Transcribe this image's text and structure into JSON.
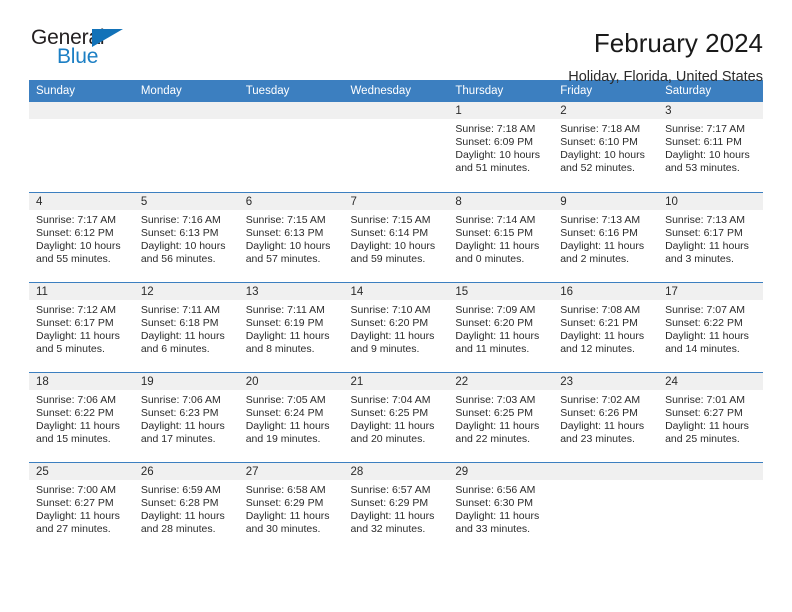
{
  "logo": {
    "word_top": "General",
    "word_bottom": "Blue",
    "triangle_color": "#1272b8",
    "blue_color": "#1c7fc4"
  },
  "header": {
    "title": "February 2024",
    "location": "Holiday, Florida, United States"
  },
  "theme": {
    "header_blue": "#3c7fc0",
    "daynum_band": "#f0f0f0",
    "text": "#2b2b2b"
  },
  "calendar": {
    "weekday_headers": [
      "Sunday",
      "Monday",
      "Tuesday",
      "Wednesday",
      "Thursday",
      "Friday",
      "Saturday"
    ],
    "labels": {
      "sunrise": "Sunrise:",
      "sunset": "Sunset:",
      "daylight": "Daylight:"
    },
    "weeks": [
      [
        {
          "day": "",
          "blank": true
        },
        {
          "day": "",
          "blank": true
        },
        {
          "day": "",
          "blank": true
        },
        {
          "day": "",
          "blank": true
        },
        {
          "day": "1",
          "sunrise": "Sunrise: 7:18 AM",
          "sunset": "Sunset: 6:09 PM",
          "daylight": "Daylight: 10 hours and 51 minutes."
        },
        {
          "day": "2",
          "sunrise": "Sunrise: 7:18 AM",
          "sunset": "Sunset: 6:10 PM",
          "daylight": "Daylight: 10 hours and 52 minutes."
        },
        {
          "day": "3",
          "sunrise": "Sunrise: 7:17 AM",
          "sunset": "Sunset: 6:11 PM",
          "daylight": "Daylight: 10 hours and 53 minutes."
        }
      ],
      [
        {
          "day": "4",
          "sunrise": "Sunrise: 7:17 AM",
          "sunset": "Sunset: 6:12 PM",
          "daylight": "Daylight: 10 hours and 55 minutes."
        },
        {
          "day": "5",
          "sunrise": "Sunrise: 7:16 AM",
          "sunset": "Sunset: 6:13 PM",
          "daylight": "Daylight: 10 hours and 56 minutes."
        },
        {
          "day": "6",
          "sunrise": "Sunrise: 7:15 AM",
          "sunset": "Sunset: 6:13 PM",
          "daylight": "Daylight: 10 hours and 57 minutes."
        },
        {
          "day": "7",
          "sunrise": "Sunrise: 7:15 AM",
          "sunset": "Sunset: 6:14 PM",
          "daylight": "Daylight: 10 hours and 59 minutes."
        },
        {
          "day": "8",
          "sunrise": "Sunrise: 7:14 AM",
          "sunset": "Sunset: 6:15 PM",
          "daylight": "Daylight: 11 hours and 0 minutes."
        },
        {
          "day": "9",
          "sunrise": "Sunrise: 7:13 AM",
          "sunset": "Sunset: 6:16 PM",
          "daylight": "Daylight: 11 hours and 2 minutes."
        },
        {
          "day": "10",
          "sunrise": "Sunrise: 7:13 AM",
          "sunset": "Sunset: 6:17 PM",
          "daylight": "Daylight: 11 hours and 3 minutes."
        }
      ],
      [
        {
          "day": "11",
          "sunrise": "Sunrise: 7:12 AM",
          "sunset": "Sunset: 6:17 PM",
          "daylight": "Daylight: 11 hours and 5 minutes."
        },
        {
          "day": "12",
          "sunrise": "Sunrise: 7:11 AM",
          "sunset": "Sunset: 6:18 PM",
          "daylight": "Daylight: 11 hours and 6 minutes."
        },
        {
          "day": "13",
          "sunrise": "Sunrise: 7:11 AM",
          "sunset": "Sunset: 6:19 PM",
          "daylight": "Daylight: 11 hours and 8 minutes."
        },
        {
          "day": "14",
          "sunrise": "Sunrise: 7:10 AM",
          "sunset": "Sunset: 6:20 PM",
          "daylight": "Daylight: 11 hours and 9 minutes."
        },
        {
          "day": "15",
          "sunrise": "Sunrise: 7:09 AM",
          "sunset": "Sunset: 6:20 PM",
          "daylight": "Daylight: 11 hours and 11 minutes."
        },
        {
          "day": "16",
          "sunrise": "Sunrise: 7:08 AM",
          "sunset": "Sunset: 6:21 PM",
          "daylight": "Daylight: 11 hours and 12 minutes."
        },
        {
          "day": "17",
          "sunrise": "Sunrise: 7:07 AM",
          "sunset": "Sunset: 6:22 PM",
          "daylight": "Daylight: 11 hours and 14 minutes."
        }
      ],
      [
        {
          "day": "18",
          "sunrise": "Sunrise: 7:06 AM",
          "sunset": "Sunset: 6:22 PM",
          "daylight": "Daylight: 11 hours and 15 minutes."
        },
        {
          "day": "19",
          "sunrise": "Sunrise: 7:06 AM",
          "sunset": "Sunset: 6:23 PM",
          "daylight": "Daylight: 11 hours and 17 minutes."
        },
        {
          "day": "20",
          "sunrise": "Sunrise: 7:05 AM",
          "sunset": "Sunset: 6:24 PM",
          "daylight": "Daylight: 11 hours and 19 minutes."
        },
        {
          "day": "21",
          "sunrise": "Sunrise: 7:04 AM",
          "sunset": "Sunset: 6:25 PM",
          "daylight": "Daylight: 11 hours and 20 minutes."
        },
        {
          "day": "22",
          "sunrise": "Sunrise: 7:03 AM",
          "sunset": "Sunset: 6:25 PM",
          "daylight": "Daylight: 11 hours and 22 minutes."
        },
        {
          "day": "23",
          "sunrise": "Sunrise: 7:02 AM",
          "sunset": "Sunset: 6:26 PM",
          "daylight": "Daylight: 11 hours and 23 minutes."
        },
        {
          "day": "24",
          "sunrise": "Sunrise: 7:01 AM",
          "sunset": "Sunset: 6:27 PM",
          "daylight": "Daylight: 11 hours and 25 minutes."
        }
      ],
      [
        {
          "day": "25",
          "sunrise": "Sunrise: 7:00 AM",
          "sunset": "Sunset: 6:27 PM",
          "daylight": "Daylight: 11 hours and 27 minutes."
        },
        {
          "day": "26",
          "sunrise": "Sunrise: 6:59 AM",
          "sunset": "Sunset: 6:28 PM",
          "daylight": "Daylight: 11 hours and 28 minutes."
        },
        {
          "day": "27",
          "sunrise": "Sunrise: 6:58 AM",
          "sunset": "Sunset: 6:29 PM",
          "daylight": "Daylight: 11 hours and 30 minutes."
        },
        {
          "day": "28",
          "sunrise": "Sunrise: 6:57 AM",
          "sunset": "Sunset: 6:29 PM",
          "daylight": "Daylight: 11 hours and 32 minutes."
        },
        {
          "day": "29",
          "sunrise": "Sunrise: 6:56 AM",
          "sunset": "Sunset: 6:30 PM",
          "daylight": "Daylight: 11 hours and 33 minutes."
        },
        {
          "day": "",
          "blank": true
        },
        {
          "day": "",
          "blank": true
        }
      ]
    ]
  }
}
